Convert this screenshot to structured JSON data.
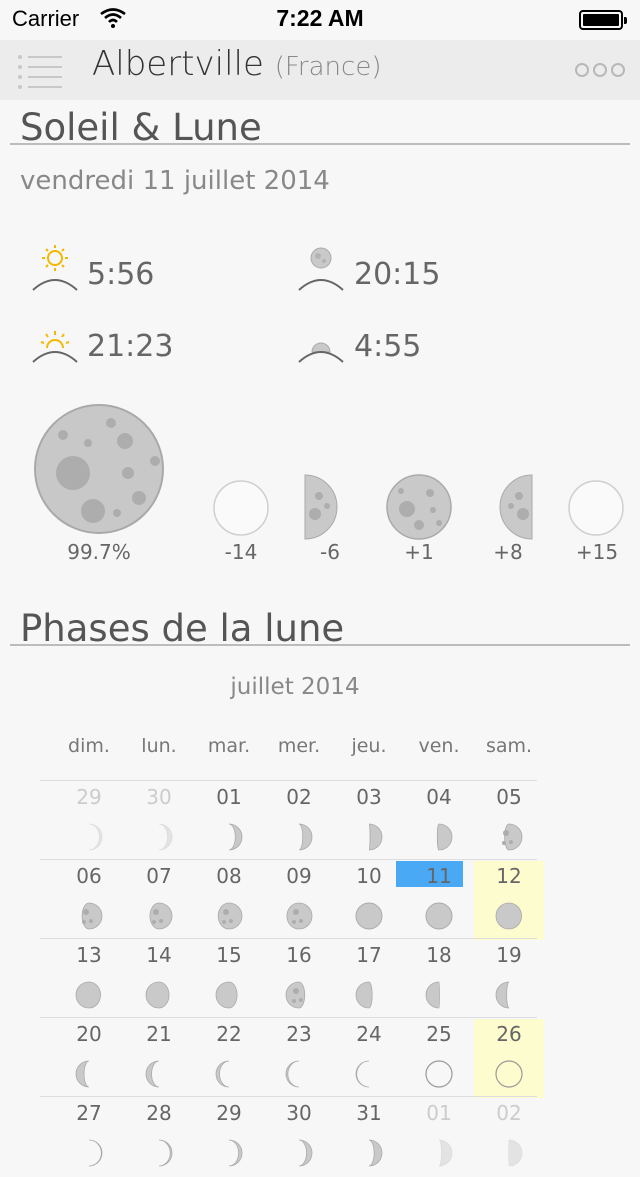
{
  "status_bar": {
    "carrier": "Carrier",
    "time": "7:22 AM"
  },
  "nav": {
    "city": "Albertville",
    "country": "(France)",
    "menu_icon": "list-icon",
    "more_icon": "ellipsis-icon"
  },
  "sun_moon": {
    "title": "Soleil & Lune",
    "date": "vendredi 11 juillet 2014",
    "sunrise": "5:56",
    "sunset": "21:23",
    "moonrise": "20:15",
    "moonset": "4:55",
    "illumination": "99.7%",
    "phase_offsets": [
      "-14",
      "-6",
      "+1",
      "+8",
      "+15"
    ]
  },
  "phases": {
    "title": "Phases de la lune",
    "month": "juillet 2014",
    "weekdays": [
      "dim.",
      "lun.",
      "mar.",
      "mer.",
      "jeu.",
      "ven.",
      "sam."
    ],
    "weeks": [
      [
        "29",
        "30",
        "01",
        "02",
        "03",
        "04",
        "05"
      ],
      [
        "06",
        "07",
        "08",
        "09",
        "10",
        "11",
        "12"
      ],
      [
        "13",
        "14",
        "15",
        "16",
        "17",
        "18",
        "19"
      ],
      [
        "20",
        "21",
        "22",
        "23",
        "24",
        "25",
        "26"
      ],
      [
        "27",
        "28",
        "29",
        "30",
        "31",
        "01",
        "02"
      ]
    ]
  },
  "colors": {
    "today": "#4aa9f5",
    "highlight": "#fdfccf",
    "sun": "#f5b800",
    "moon": "#c9c9c9"
  }
}
